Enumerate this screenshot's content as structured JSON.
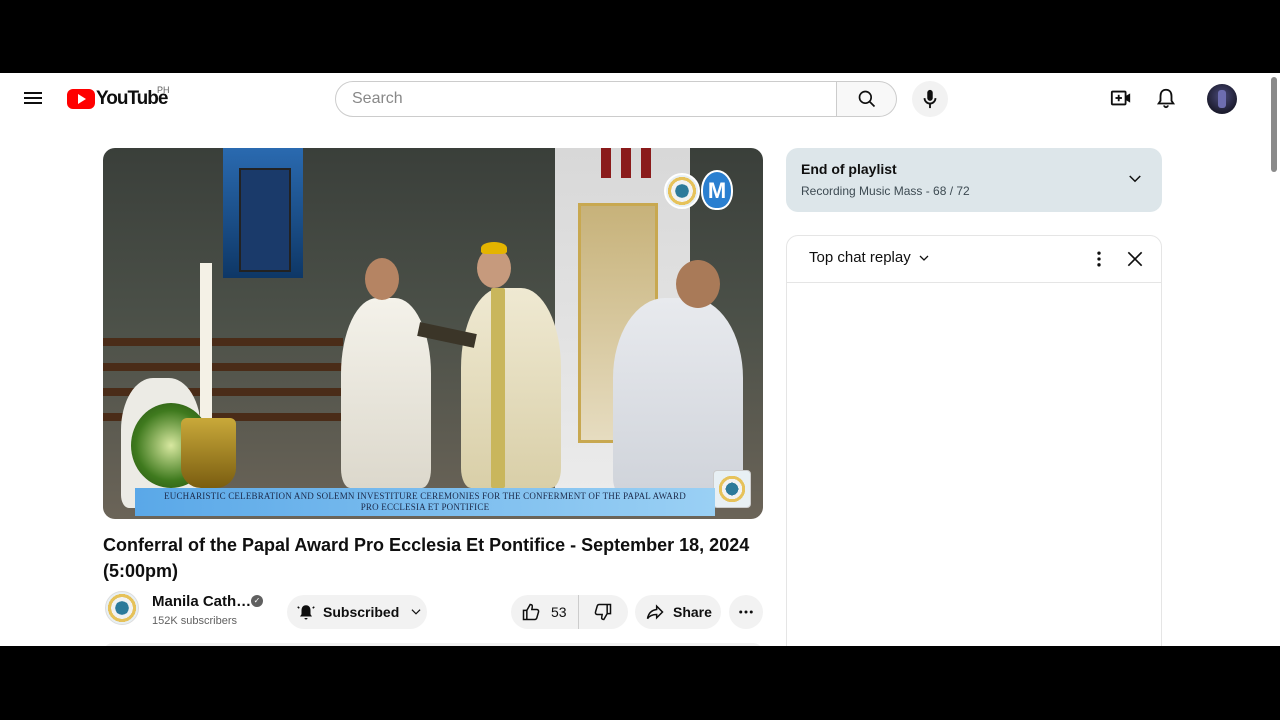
{
  "header": {
    "logo_text": "YouTube",
    "region": "PH",
    "search_placeholder": "Search"
  },
  "video": {
    "overlay_line1": "EUCHARISTIC CELEBRATION AND SOLEMN INVESTITURE CEREMONIES FOR THE CONFERMENT OF THE PAPAL AWARD",
    "overlay_line2": "PRO ECCLESIA ET PONTIFICE",
    "title": "Conferral of the Papal Award Pro Ecclesia Et Pontifice - September 18, 2024 (5:00pm)"
  },
  "channel": {
    "name": "Manila Cath…",
    "subscribers": "152K subscribers",
    "subscribed_label": "Subscribed"
  },
  "actions": {
    "like_count": "53",
    "share_label": "Share"
  },
  "playlist": {
    "title": "End of playlist",
    "subtitle": "Recording Music Mass - 68 / 72"
  },
  "chat": {
    "title": "Top chat replay"
  },
  "colors": {
    "brand_red": "#ff0000",
    "playlist_bg": "#dde6ea"
  },
  "icons": [
    "menu-icon",
    "youtube-logo-icon",
    "search-icon",
    "mic-icon",
    "create-icon",
    "bell-icon",
    "verified-icon",
    "bell-ring-icon",
    "chevron-down-icon",
    "thumbs-up-icon",
    "thumbs-down-icon",
    "share-icon",
    "more-horiz-icon",
    "more-vert-icon",
    "close-icon"
  ]
}
